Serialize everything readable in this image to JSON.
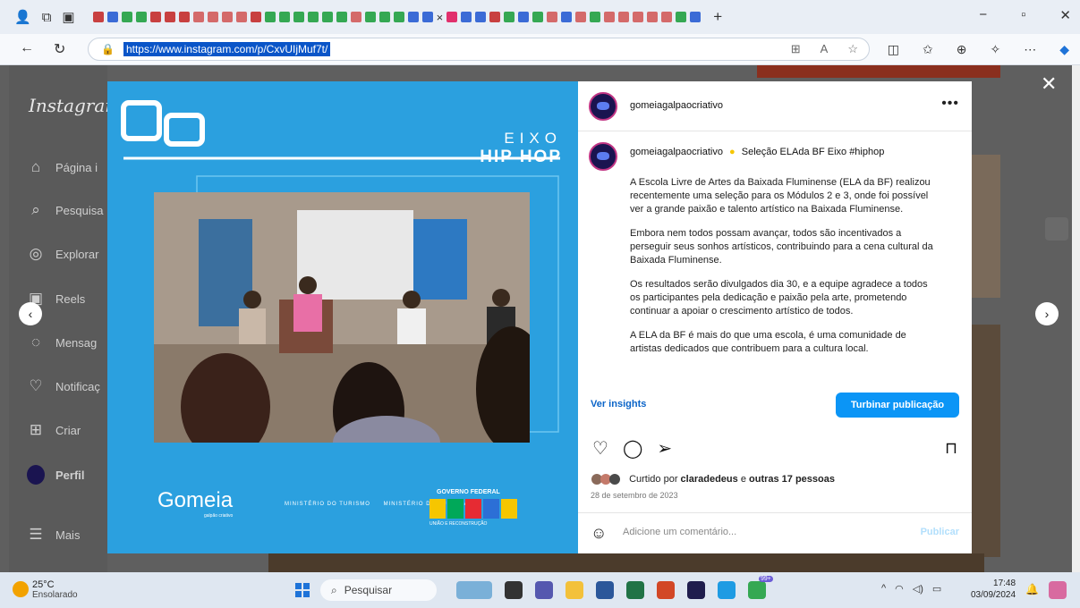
{
  "browser": {
    "url": "https://www.instagram.com/p/CxvUIjMuf7t/",
    "window_controls": [
      "−",
      "▫",
      "✕"
    ],
    "new_tab_label": "+"
  },
  "sidebar": {
    "logo": "Instagram",
    "items": [
      {
        "label": "Página i",
        "icon": "home-icon"
      },
      {
        "label": "Pesquisa",
        "icon": "search-icon"
      },
      {
        "label": "Explorar",
        "icon": "explore-icon"
      },
      {
        "label": "Reels",
        "icon": "reels-icon"
      },
      {
        "label": "Mensag",
        "icon": "messages-icon"
      },
      {
        "label": "Notificaç",
        "icon": "heart-icon"
      },
      {
        "label": "Criar",
        "icon": "create-icon"
      },
      {
        "label": "Perfil",
        "icon": "profile-avatar"
      },
      {
        "label": "Mais",
        "icon": "menu-icon"
      }
    ]
  },
  "post_image": {
    "eixo": "EIXO",
    "hip_hop": "HIP HOP",
    "gomeia": "Gomeia",
    "gomeia_sub": "galpão criativo",
    "ministerio_turismo": "MINISTÉRIO DO TURISMO",
    "ministerio_cultura": "MINISTÉRIO DA CULTURA",
    "governo_federal": "GOVERNO FEDERAL",
    "uniao": "UNIÃO E RECONSTRUÇÃO"
  },
  "post": {
    "username": "gomeiagalpaocriativo",
    "caption_header": "Seleção ELAda BF Eixo #hiphop",
    "paragraphs": [
      "A Escola Livre de Artes da Baixada Fluminense (ELA da BF) realizou recentemente uma seleção para os Módulos 2 e 3, onde foi possível ver a grande paixão e talento artístico na Baixada Fluminense.",
      "Embora nem todos possam avançar, todos são incentivados a perseguir seus sonhos artísticos, contribuindo para a cena cultural da Baixada Fluminense.",
      "Os resultados serão divulgados dia 30, e a equipe agradece a todos os participantes pela dedicação e paixão pela arte, prometendo continuar a apoiar o crescimento artístico de todos.",
      "A ELA da BF é mais do que uma escola, é uma comunidade de artistas dedicados que contribuem para a cultura local."
    ],
    "insights_label": "Ver insights",
    "boost_label": "Turbinar publicação",
    "likes_prefix": "Curtido por",
    "likes_user": "claradedeus",
    "likes_suffix": "e",
    "likes_others": "outras 17 pessoas",
    "date": "28 de setembro de 2023",
    "comment_placeholder": "Adicione um comentário...",
    "publish_label": "Publicar"
  },
  "taskbar": {
    "temperature": "25°C",
    "weather": "Ensolarado",
    "search_label": "Pesquisar",
    "notifications_badge": "99+",
    "time": "17:48",
    "date": "03/09/2024"
  }
}
